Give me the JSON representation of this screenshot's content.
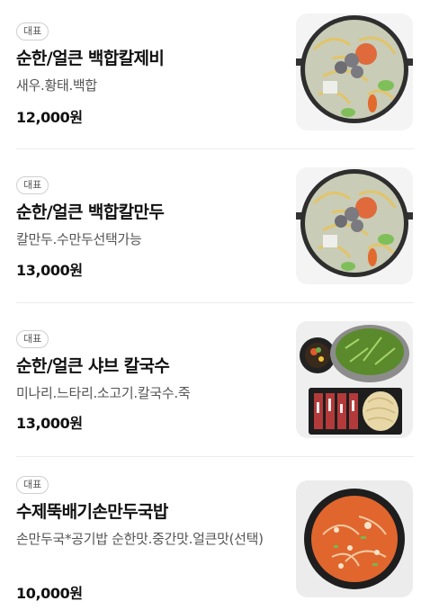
{
  "menu": {
    "items": [
      {
        "badge": "대표",
        "name": "순한/얼큰 백합칼제비",
        "description": "새우.황태.백합",
        "price": "12,000원",
        "image": "clam-kalguksu-photo"
      },
      {
        "badge": "대표",
        "name": "순한/얼큰 백합칼만두",
        "description": "칼만두.수만두선택가능",
        "price": "13,000원",
        "image": "clam-dumpling-noodle-photo"
      },
      {
        "badge": "대표",
        "name": "순한/얼큰 샤브 칼국수",
        "description": "미나리.느타리.소고기.칼국수.죽",
        "price": "13,000원",
        "image": "shabu-kalguksu-photo"
      },
      {
        "badge": "대표",
        "name": "수제뚝배기손만두국밥",
        "description": "손만두국*공기밥 순한맛.중간맛.얼큰맛(선택)",
        "price": "10,000원",
        "image": "dumpling-gukbap-photo"
      }
    ]
  }
}
